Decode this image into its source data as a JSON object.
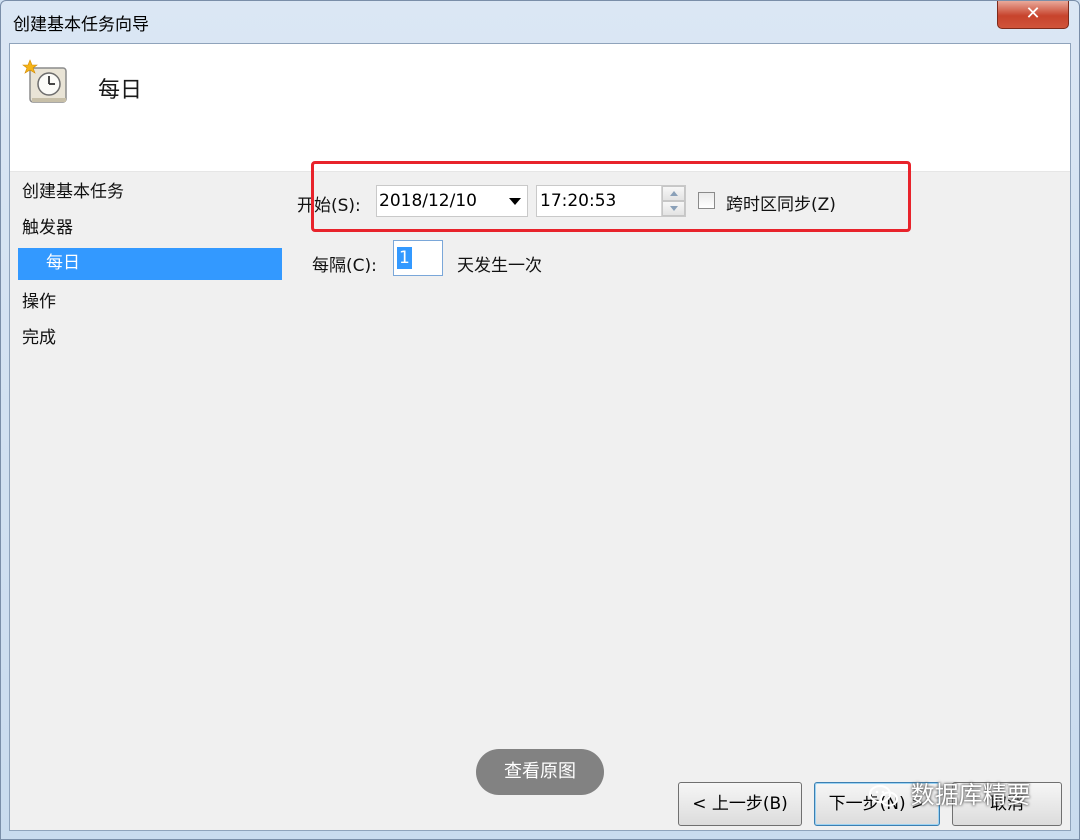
{
  "window": {
    "title": "创建基本任务向导",
    "close_glyph": "✕"
  },
  "header": {
    "title": "每日",
    "icon": "clock-task-icon"
  },
  "sidebar": {
    "steps": [
      {
        "label": "创建基本任务"
      },
      {
        "label": "触发器"
      },
      {
        "label": "每日",
        "selected": true
      },
      {
        "label": "操作"
      },
      {
        "label": "完成"
      }
    ]
  },
  "form": {
    "start_label": "开始(S):",
    "start_date": "2018/12/10",
    "start_time": "17:20:53",
    "sync_timezone_label": "跨时区同步(Z)",
    "sync_timezone_checked": false,
    "recur_label": "每隔(C):",
    "recur_value": "1",
    "recur_suffix": "天发生一次"
  },
  "buttons": {
    "back": "< 上一步(B)",
    "next": "下一步(N) >",
    "cancel": "取消"
  },
  "overlay": {
    "view_original": "查看原图",
    "watermark": "数据库精要"
  },
  "colors": {
    "selection": "#3399ff",
    "highlight_box": "#e8232b",
    "close_button": "#c7432c"
  }
}
